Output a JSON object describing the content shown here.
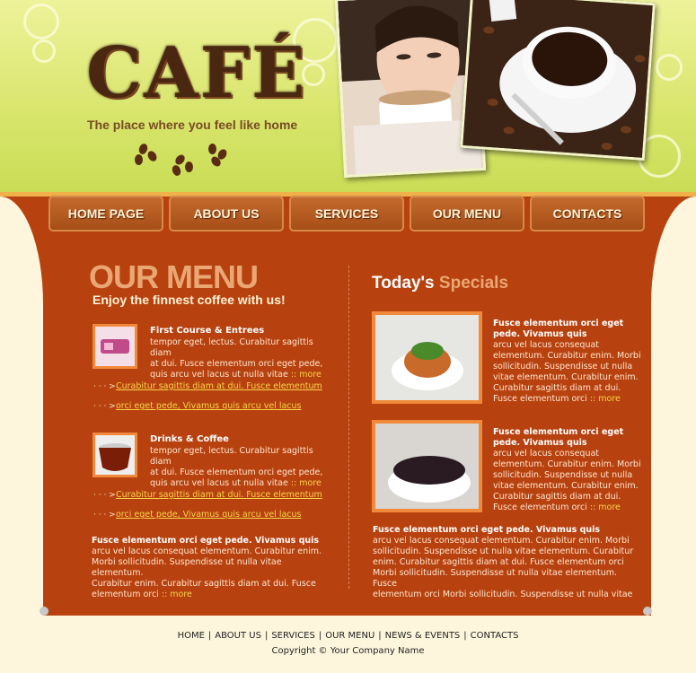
{
  "logo": {
    "text": "CAFÉ",
    "tagline": "The place where you feel like home"
  },
  "nav": [
    "HOME PAGE",
    "ABOUT US",
    "SERVICES",
    "OUR MENU",
    "CONTACTS"
  ],
  "menu": {
    "title": "OUR MENU",
    "subtitle": "Enjoy the finnest coffee with us!",
    "entries": [
      {
        "title": "First Course & Entrees",
        "lines": [
          "tempor eget, lectus. Curabitur sagittis diam",
          "at dui. Fusce elementum orci eget pede,",
          "quis arcu vel lacus ut nulla vitae"
        ],
        "more": ":: more",
        "links": [
          "Curabitur sagittis diam at dui. Fusce elementum",
          "orci eget pede, Vivamus quis arcu vel lacus"
        ]
      },
      {
        "title": "Drinks & Coffee",
        "lines": [
          "tempor eget, lectus. Curabitur sagittis diam",
          "at dui. Fusce elementum orci eget pede,",
          "quis arcu vel lacus ut nulla vitae"
        ],
        "more": ":: more",
        "links": [
          "Curabitur sagittis diam at dui. Fusce elementum",
          "orci eget pede, Vivamus quis arcu vel lacus"
        ]
      }
    ],
    "bottom": {
      "title": "Fusce elementum orci eget pede. Vivamus quis",
      "lines": [
        "arcu vel lacus consequat elementum. Curabitur enim.",
        "Morbi sollicitudin. Suspendisse ut nulla vitae elementum.",
        "Curabitur enim.  Curabitur sagittis diam at dui. Fusce",
        "elementum orci"
      ],
      "more": ":: more"
    }
  },
  "specials": {
    "title_a": "Today's",
    "title_b": "Specials",
    "items": [
      {
        "title": [
          "Fusce elementum orci eget",
          "pede. Vivamus quis"
        ],
        "lines": [
          "arcu vel lacus consequat",
          "elementum. Curabitur enim. Morbi",
          "sollicitudin. Suspendisse ut nulla",
          "vitae elementum. Curabitur enim.",
          "Curabitur sagittis diam at dui.",
          "Fusce elementum orci"
        ],
        "more": ":: more"
      },
      {
        "title": [
          "Fusce elementum orci eget",
          "pede. Vivamus quis"
        ],
        "lines": [
          "arcu vel lacus consequat",
          "elementum. Curabitur enim. Morbi",
          "sollicitudin. Suspendisse ut nulla",
          "vitae elementum. Curabitur enim.",
          "Curabitur sagittis diam at dui.",
          "Fusce elementum orci"
        ],
        "more": ":: more"
      }
    ],
    "bottom": {
      "title": "Fusce elementum orci eget pede. Vivamus quis",
      "lines": [
        "arcu vel lacus consequat elementum. Curabitur enim. Morbi",
        "sollicitudin. Suspendisse ut nulla vitae elementum. Curabitur",
        "enim.  Curabitur sagittis diam at dui. Fusce elementum orci",
        "Morbi sollicitudin. Suspendisse ut nulla vitae elementum.  Fusce",
        "elementum orci Morbi sollicitudin. Suspendisse ut nulla vitae"
      ]
    }
  },
  "footer": {
    "links": [
      "HOME",
      "ABOUT US",
      "SERVICES",
      "OUR MENU",
      "NEWS & EVENTS",
      "CONTACTS"
    ],
    "separator": "|",
    "copyright": "Copyright © Your Company Name"
  },
  "colors": {
    "accent": "#b8420f",
    "header": "#d7e56a",
    "link": "#f7d44a",
    "background": "#fdf6dd"
  }
}
